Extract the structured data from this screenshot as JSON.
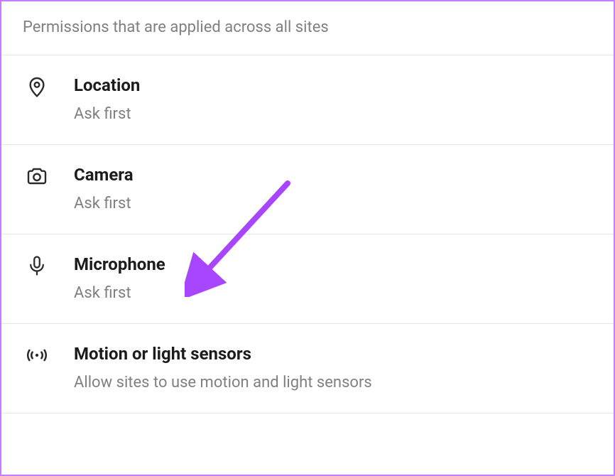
{
  "header": {
    "description": "Permissions that are applied across all sites"
  },
  "permissions": [
    {
      "title": "Location",
      "subtitle": "Ask first"
    },
    {
      "title": "Camera",
      "subtitle": "Ask first"
    },
    {
      "title": "Microphone",
      "subtitle": "Ask first"
    },
    {
      "title": "Motion or light sensors",
      "subtitle": "Allow sites to use motion and light sensors"
    }
  ],
  "annotation": {
    "arrow_color": "#a846ff",
    "points_to": "Microphone"
  }
}
